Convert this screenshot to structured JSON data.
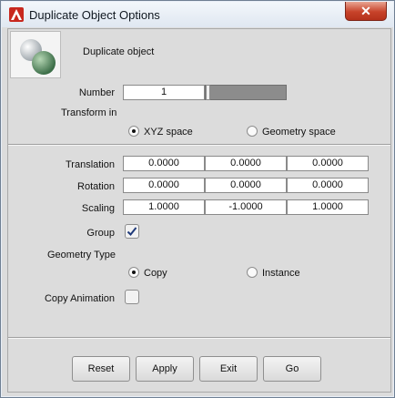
{
  "window": {
    "title": "Duplicate Object Options",
    "close_glyph": "✕"
  },
  "header": {
    "label": "Duplicate object",
    "icon": "duplicate-spheres-icon"
  },
  "number": {
    "label": "Number",
    "value": "1",
    "slider_fraction": 0.0
  },
  "transform": {
    "label": "Transform in",
    "options": [
      "XYZ space",
      "Geometry space"
    ],
    "selected": "XYZ space"
  },
  "translation": {
    "label": "Translation",
    "values": [
      "0.0000",
      "0.0000",
      "0.0000"
    ]
  },
  "rotation": {
    "label": "Rotation",
    "values": [
      "0.0000",
      "0.0000",
      "0.0000"
    ]
  },
  "scaling": {
    "label": "Scaling",
    "values": [
      "1.0000",
      "-1.0000",
      "1.0000"
    ]
  },
  "group": {
    "label": "Group",
    "checked": true
  },
  "geometry_type": {
    "label": "Geometry Type",
    "options": [
      "Copy",
      "Instance"
    ],
    "selected": "Copy"
  },
  "copy_animation": {
    "label": "Copy Animation",
    "checked": false
  },
  "buttons": {
    "reset": "Reset",
    "apply": "Apply",
    "exit": "Exit",
    "go": "Go"
  },
  "colors": {
    "close_button": "#c7432a",
    "app_icon": "#c8281e"
  }
}
